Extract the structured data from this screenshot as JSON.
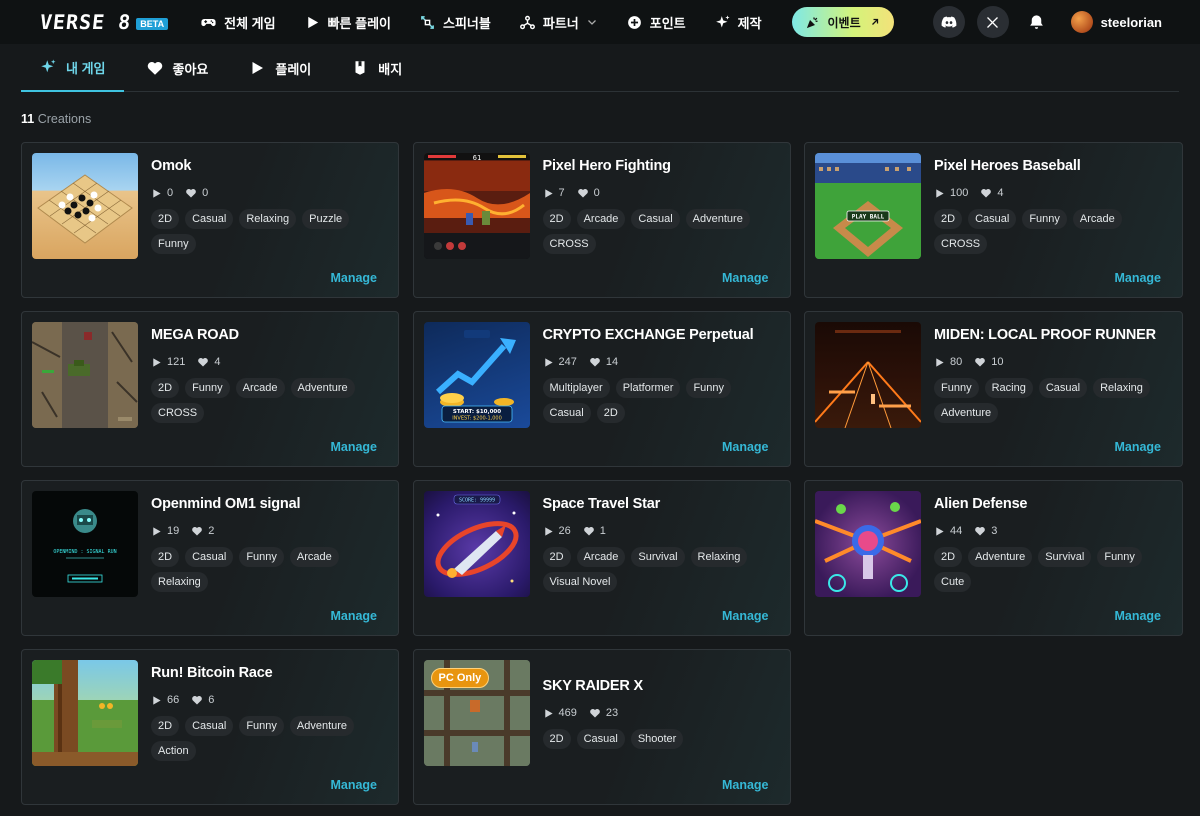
{
  "header": {
    "logo_text": "VERSE 8",
    "beta_label": "BETA",
    "nav": [
      {
        "label": "전체 게임",
        "icon": "gamepad-icon"
      },
      {
        "label": "빠른 플레이",
        "icon": "play-icon"
      },
      {
        "label": "스피너블",
        "icon": "spinnable-icon"
      },
      {
        "label": "파트너",
        "icon": "partner-icon"
      },
      {
        "label": "포인트",
        "icon": "point-icon"
      },
      {
        "label": "제작",
        "icon": "sparkle-icon"
      }
    ],
    "event_label": "이벤트",
    "username": "steelorian"
  },
  "tabs": [
    {
      "label": "내 게임",
      "icon": "sparkle-icon",
      "active": true
    },
    {
      "label": "좋아요",
      "icon": "heart-icon"
    },
    {
      "label": "플레이",
      "icon": "play-icon"
    },
    {
      "label": "배지",
      "icon": "badge-icon"
    }
  ],
  "creations": {
    "count": "11",
    "label": "Creations"
  },
  "games": [
    {
      "title": "Omok",
      "plays": "0",
      "likes": "0",
      "tags": [
        "2D",
        "Casual",
        "Relaxing",
        "Puzzle",
        "Funny"
      ]
    },
    {
      "title": "Pixel Hero Fighting",
      "plays": "7",
      "likes": "0",
      "tags": [
        "2D",
        "Arcade",
        "Casual",
        "Adventure",
        "CROSS"
      ],
      "thumb_text": "61"
    },
    {
      "title": "Pixel Heroes Baseball",
      "plays": "100",
      "likes": "4",
      "tags": [
        "2D",
        "Casual",
        "Funny",
        "Arcade",
        "CROSS"
      ],
      "thumb_text": "PLAY BALL"
    },
    {
      "title": "MEGA ROAD",
      "plays": "121",
      "likes": "4",
      "tags": [
        "2D",
        "Funny",
        "Arcade",
        "Adventure",
        "CROSS"
      ]
    },
    {
      "title": "CRYPTO EXCHANGE Perpetual",
      "plays": "247",
      "likes": "14",
      "tags": [
        "Multiplayer",
        "Platformer",
        "Funny",
        "Casual",
        "2D"
      ],
      "thumb_text": "START: $10,000",
      "thumb_text2": "INVEST: $200-1,000"
    },
    {
      "title": "MIDEN: LOCAL PROOF RUNNER",
      "plays": "80",
      "likes": "10",
      "tags": [
        "Funny",
        "Racing",
        "Casual",
        "Relaxing",
        "Adventure"
      ]
    },
    {
      "title": "Openmind OM1 signal",
      "plays": "19",
      "likes": "2",
      "tags": [
        "2D",
        "Casual",
        "Funny",
        "Arcade",
        "Relaxing"
      ],
      "thumb_text": "OPENMIND : SIGNAL RUN"
    },
    {
      "title": "Space Travel Star",
      "plays": "26",
      "likes": "1",
      "tags": [
        "2D",
        "Arcade",
        "Survival",
        "Relaxing",
        "Visual Novel"
      ],
      "thumb_text": "SCORE: 99999"
    },
    {
      "title": "Alien Defense",
      "plays": "44",
      "likes": "3",
      "tags": [
        "2D",
        "Adventure",
        "Survival",
        "Funny",
        "Cute"
      ]
    },
    {
      "title": "Run! Bitcoin Race",
      "plays": "66",
      "likes": "6",
      "tags": [
        "2D",
        "Casual",
        "Funny",
        "Adventure",
        "Action"
      ]
    },
    {
      "title": "SKY RAIDER X",
      "plays": "469",
      "likes": "23",
      "tags": [
        "2D",
        "Casual",
        "Shooter"
      ],
      "badge": "PC Only"
    }
  ],
  "manage_label": "Manage",
  "colors": {
    "accent": "#35b8d6",
    "background": "#16191b",
    "tag_bg": "#262a2d"
  }
}
